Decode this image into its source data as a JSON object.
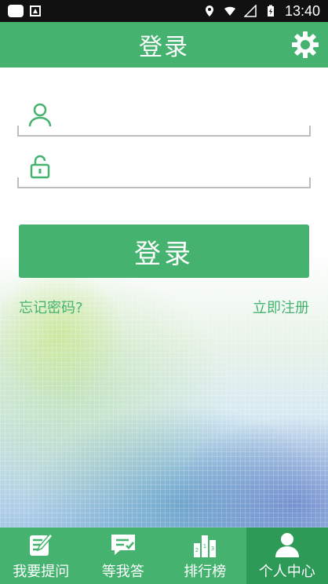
{
  "status_bar": {
    "time": "13:40"
  },
  "app_bar": {
    "title": "登录"
  },
  "login_form": {
    "username_placeholder": "",
    "password_placeholder": "",
    "login_button_label": "登录",
    "forgot_password_label": "忘记密码?",
    "register_label": "立即注册"
  },
  "tab_bar": {
    "items": [
      {
        "label": "我要提问",
        "icon": "edit-icon",
        "active": false
      },
      {
        "label": "等我答",
        "icon": "chat-check-icon",
        "active": false
      },
      {
        "label": "排行榜",
        "icon": "ranking-icon",
        "active": false
      },
      {
        "label": "个人中心",
        "icon": "person-icon",
        "active": true
      }
    ]
  },
  "colors": {
    "primary": "#45b36f",
    "active_tab": "#2e9a57"
  }
}
